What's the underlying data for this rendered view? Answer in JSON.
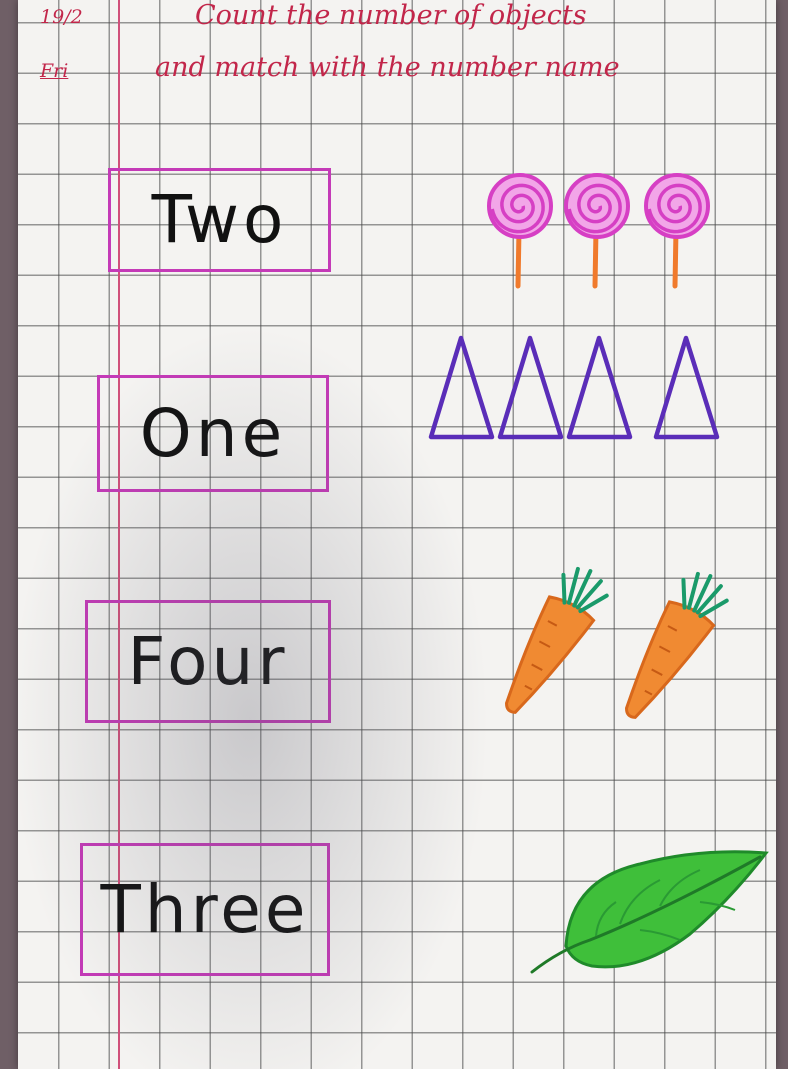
{
  "header": {
    "date_day": "19/2",
    "date_weekday": "Fri",
    "title_line1": "Count the number of objects",
    "title_line2": "and match with the number name"
  },
  "number_names": [
    "Two",
    "One",
    "Four",
    "Three"
  ],
  "objects": [
    {
      "icon": "lollipop-icon",
      "count": 3
    },
    {
      "icon": "triangle-icon",
      "count": 4
    },
    {
      "icon": "carrot-icon",
      "count": 2
    },
    {
      "icon": "leaf-icon",
      "count": 1
    }
  ],
  "colors": {
    "heading_ink": "#c2264a",
    "box_border": "#c43ab7",
    "lollipop_pink": "#d63fc4",
    "stick_orange": "#f07a2c",
    "triangle_purple": "#5a2db8",
    "carrot_orange": "#f08a32",
    "carrot_greens": "#1a9a6a",
    "leaf_green": "#3fbf3a"
  }
}
